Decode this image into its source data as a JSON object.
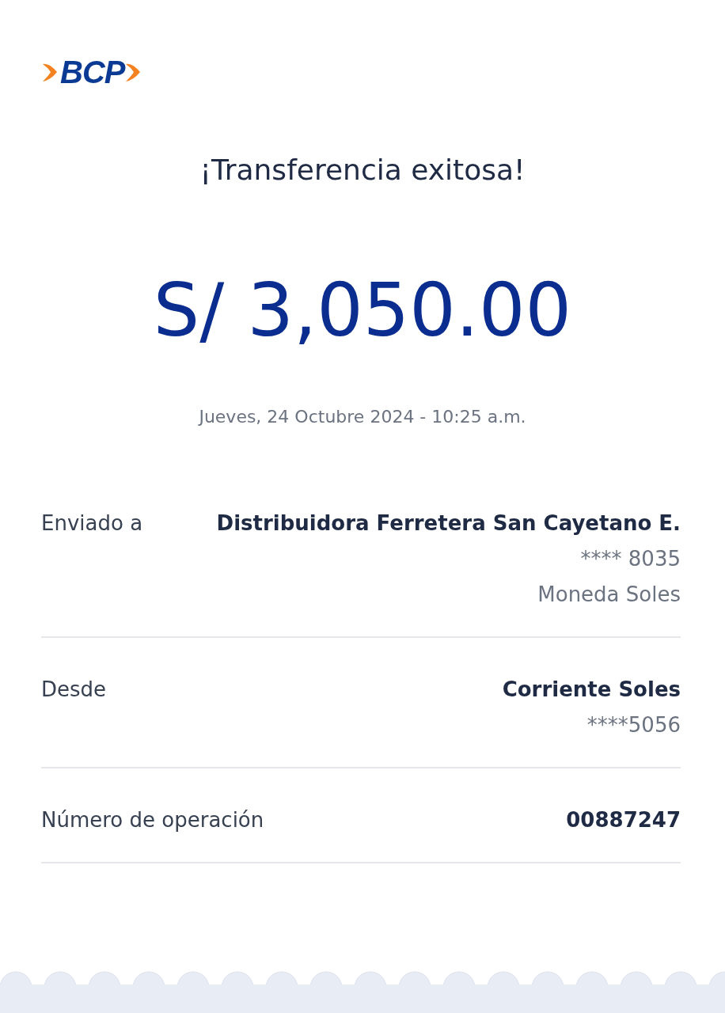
{
  "logo": {
    "text": "BCP"
  },
  "title": "¡Transferencia exitosa!",
  "amount": "S/ 3,050.00",
  "datetime": "Jueves, 24 Octubre 2024 - 10:25 a.m.",
  "details": [
    {
      "label": "Enviado a",
      "values": [
        {
          "text": "Distribuidora Ferretera San Cayetano E.",
          "kind": "primary"
        },
        {
          "text": "**** 8035",
          "kind": "secondary"
        },
        {
          "text": "Moneda Soles",
          "kind": "secondary"
        }
      ]
    },
    {
      "label": "Desde",
      "values": [
        {
          "text": "Corriente Soles",
          "kind": "primary"
        },
        {
          "text": "****5056",
          "kind": "secondary"
        }
      ]
    },
    {
      "label": "Número de operación",
      "values": [
        {
          "text": "00887247",
          "kind": "primary"
        }
      ]
    }
  ]
}
